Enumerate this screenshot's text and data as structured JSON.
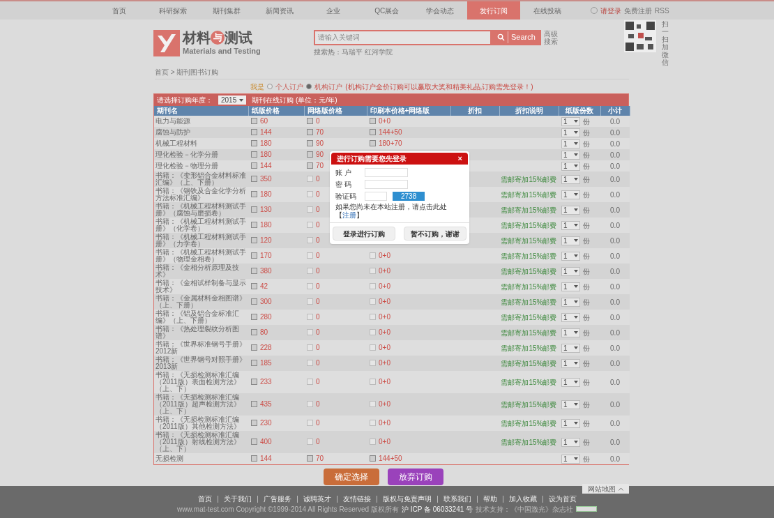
{
  "nav": {
    "items": [
      {
        "label": "首页",
        "selected": false
      },
      {
        "label": "科研探索",
        "selected": false
      },
      {
        "label": "期刊集群",
        "selected": false
      },
      {
        "label": "新闻资讯",
        "selected": false
      },
      {
        "label": "企业",
        "selected": false
      },
      {
        "label": "QC展会",
        "selected": false
      },
      {
        "label": "学会动态",
        "selected": false
      },
      {
        "label": "发行订阅",
        "selected": true
      },
      {
        "label": "在线投稿",
        "selected": false
      }
    ],
    "login": "请登录",
    "register": "免费注册",
    "rss": "RSS"
  },
  "header": {
    "logo_cn": "材料",
    "logo_mid": "与",
    "logo_cn2": "测试",
    "logo_en": "Materials and Testing",
    "search_placeholder": "请输入关键词",
    "search_button": "Search",
    "advanced": "高级搜索",
    "hot": "搜索热：马瑞平 红河学院",
    "qr_caption": "扫一扫加微信"
  },
  "breadcrumb": "首页 > 期刊图书订购",
  "subscriber": {
    "prefix": "我是",
    "options": [
      {
        "label": "个人订户",
        "selected": false
      },
      {
        "label": "机构订户",
        "selected": true
      }
    ],
    "note": "(机构订户全价订购可以赢取大奖和精美礼品,订购需先登录！)"
  },
  "table": {
    "year_label": "请选择订购年度：",
    "year": "2015",
    "caption": "期刊在线订购 (单位：元/年)",
    "columns": [
      "期刊名",
      "纸版价格",
      "网络版价格",
      "印刷本价格+网络版",
      "折扣",
      "折扣说明",
      "纸版份数",
      "小计"
    ],
    "rows": [
      {
        "name": "电力与能源",
        "paper": {
          "price": "60",
          "checked": false
        },
        "net": {
          "price": "0",
          "checked": false,
          "disabled": false
        },
        "print_net": {
          "price": "0+0",
          "checked": false,
          "disabled": false
        },
        "copies": "1",
        "unit": "份",
        "subtotal": "0.0"
      },
      {
        "name": "腐蚀与防护",
        "paper": {
          "price": "144",
          "checked": false
        },
        "net": {
          "price": "70",
          "checked": false,
          "disabled": false
        },
        "print_net": {
          "price": "144+50",
          "checked": false,
          "disabled": false
        },
        "copies": "1",
        "unit": "份",
        "subtotal": "0.0"
      },
      {
        "name": "机械工程材料",
        "paper": {
          "price": "180",
          "checked": false
        },
        "net": {
          "price": "90",
          "checked": false,
          "disabled": false
        },
        "print_net": {
          "price": "180+70",
          "checked": false,
          "disabled": false
        },
        "copies": "1",
        "unit": "份",
        "subtotal": "0.0"
      },
      {
        "name": "理化检验－化学分册",
        "paper": {
          "price": "180",
          "checked": false
        },
        "net": {
          "price": "90",
          "checked": false,
          "disabled": false
        },
        "copies": "1",
        "unit": "份",
        "subtotal": "0.0"
      },
      {
        "name": "理化检验－物理分册",
        "paper": {
          "price": "144",
          "checked": false
        },
        "net": {
          "price": "70",
          "checked": false,
          "disabled": false
        },
        "copies": "1",
        "unit": "份",
        "subtotal": "0.0"
      },
      {
        "name": "书籍：《变形铝合金材料标准汇编》（上、下册）",
        "paper": {
          "price": "350",
          "checked": false
        },
        "net": {
          "price": "0",
          "checked": false,
          "disabled": true
        },
        "note": "需邮寄加15%邮费",
        "copies": "1",
        "unit": "份",
        "subtotal": "0.0"
      },
      {
        "name": "书籍：《钢铁及合金化学分析方法标准汇编》",
        "paper": {
          "price": "180",
          "checked": false
        },
        "net": {
          "price": "0",
          "checked": false,
          "disabled": true
        },
        "note": "需邮寄加15%邮费",
        "copies": "1",
        "unit": "份",
        "subtotal": "0.0"
      },
      {
        "name": "书籍：《机械工程材料测试手册》（腐蚀与磨损卷）",
        "paper": {
          "price": "130",
          "checked": false
        },
        "net": {
          "price": "0",
          "checked": false,
          "disabled": true
        },
        "note": "需邮寄加15%邮费",
        "copies": "1",
        "unit": "份",
        "subtotal": "0.0"
      },
      {
        "name": "书籍：《机械工程材料测试手册》（化学卷）",
        "paper": {
          "price": "180",
          "checked": false
        },
        "net": {
          "price": "0",
          "checked": false,
          "disabled": true
        },
        "note": "需邮寄加15%邮费",
        "copies": "1",
        "unit": "份",
        "subtotal": "0.0"
      },
      {
        "name": "书籍：《机械工程材料测试手册》（力学卷）",
        "paper": {
          "price": "120",
          "checked": false
        },
        "net": {
          "price": "0",
          "checked": false,
          "disabled": true
        },
        "note": "需邮寄加15%邮费",
        "copies": "1",
        "unit": "份",
        "subtotal": "0.0"
      },
      {
        "name": "书籍：《机械工程材料测试手册》（物理金相卷）",
        "paper": {
          "price": "170",
          "checked": false
        },
        "net": {
          "price": "0",
          "checked": false,
          "disabled": true
        },
        "print_net": {
          "price": "0+0",
          "checked": false,
          "disabled": true
        },
        "note": "需邮寄加15%邮费",
        "copies": "1",
        "unit": "份",
        "subtotal": "0.0"
      },
      {
        "name": "书籍：《金相分析原理及技术》",
        "paper": {
          "price": "380",
          "checked": false
        },
        "net": {
          "price": "0",
          "checked": false,
          "disabled": true
        },
        "print_net": {
          "price": "0+0",
          "checked": false,
          "disabled": true
        },
        "note": "需邮寄加15%邮费",
        "copies": "1",
        "unit": "份",
        "subtotal": "0.0"
      },
      {
        "name": "书籍：《金相试样制备与显示技术》",
        "paper": {
          "price": "42",
          "checked": false
        },
        "net": {
          "price": "0",
          "checked": false,
          "disabled": true
        },
        "print_net": {
          "price": "0+0",
          "checked": false,
          "disabled": true
        },
        "note": "需邮寄加15%邮费",
        "copies": "1",
        "unit": "份",
        "subtotal": "0.0"
      },
      {
        "name": "书籍：《金属材料金相图谱》（上、下册）",
        "paper": {
          "price": "300",
          "checked": false
        },
        "net": {
          "price": "0",
          "checked": false,
          "disabled": true
        },
        "print_net": {
          "price": "0+0",
          "checked": false,
          "disabled": true
        },
        "note": "需邮寄加15%邮费",
        "copies": "1",
        "unit": "份",
        "subtotal": "0.0"
      },
      {
        "name": "书籍：《铝及铝合金标准汇编》（上、下册）",
        "paper": {
          "price": "280",
          "checked": false
        },
        "net": {
          "price": "0",
          "checked": false,
          "disabled": true
        },
        "print_net": {
          "price": "0+0",
          "checked": false,
          "disabled": true
        },
        "note": "需邮寄加15%邮费",
        "copies": "1",
        "unit": "份",
        "subtotal": "0.0"
      },
      {
        "name": "书籍：《热处理裂纹分析图谱》",
        "paper": {
          "price": "80",
          "checked": false
        },
        "net": {
          "price": "0",
          "checked": false,
          "disabled": true
        },
        "print_net": {
          "price": "0+0",
          "checked": false,
          "disabled": true
        },
        "note": "需邮寄加15%邮费",
        "copies": "1",
        "unit": "份",
        "subtotal": "0.0"
      },
      {
        "name": "书籍：《世界标准钢号手册》2012新",
        "paper": {
          "price": "228",
          "checked": false
        },
        "net": {
          "price": "0",
          "checked": false,
          "disabled": true
        },
        "print_net": {
          "price": "0+0",
          "checked": false,
          "disabled": true
        },
        "note": "需邮寄加15%邮费",
        "copies": "1",
        "unit": "份",
        "subtotal": "0.0"
      },
      {
        "name": "书籍：《世界钢号对照手册》2013新",
        "paper": {
          "price": "185",
          "checked": false
        },
        "net": {
          "price": "0",
          "checked": false,
          "disabled": true
        },
        "print_net": {
          "price": "0+0",
          "checked": false,
          "disabled": true
        },
        "note": "需邮寄加15%邮费",
        "copies": "1",
        "unit": "份",
        "subtotal": "0.0"
      },
      {
        "name": "书籍：《无损检测标准汇编（2011版）表面检测方法》（上、下）",
        "paper": {
          "price": "233",
          "checked": false
        },
        "net": {
          "price": "0",
          "checked": false,
          "disabled": true
        },
        "print_net": {
          "price": "0+0",
          "checked": false,
          "disabled": true
        },
        "note": "需邮寄加15%邮费",
        "copies": "1",
        "unit": "份",
        "subtotal": "0.0"
      },
      {
        "name": "书籍：《无损检测标准汇编（2011版）超声检测方法》（上、下）",
        "paper": {
          "price": "435",
          "checked": false
        },
        "net": {
          "price": "0",
          "checked": false,
          "disabled": true
        },
        "print_net": {
          "price": "0+0",
          "checked": false,
          "disabled": true
        },
        "note": "需邮寄加15%邮费",
        "copies": "1",
        "unit": "份",
        "subtotal": "0.0"
      },
      {
        "name": "书籍：《无损检测标准汇编（2011版）其他检测方法》",
        "paper": {
          "price": "230",
          "checked": false
        },
        "net": {
          "price": "0",
          "checked": false,
          "disabled": true
        },
        "print_net": {
          "price": "0+0",
          "checked": false,
          "disabled": true
        },
        "note": "需邮寄加15%邮费",
        "copies": "1",
        "unit": "份",
        "subtotal": "0.0"
      },
      {
        "name": "书籍：《无损检测标准汇编（2011版）射线检测方法》（上、下）",
        "paper": {
          "price": "400",
          "checked": false
        },
        "net": {
          "price": "0",
          "checked": false,
          "disabled": true
        },
        "print_net": {
          "price": "0+0",
          "checked": false,
          "disabled": true
        },
        "note": "需邮寄加15%邮费",
        "copies": "1",
        "unit": "份",
        "subtotal": "0.0"
      },
      {
        "name": "无损检测",
        "paper": {
          "price": "144",
          "checked": false
        },
        "net": {
          "price": "70",
          "checked": false,
          "disabled": false
        },
        "print_net": {
          "price": "144+50",
          "checked": false,
          "disabled": false
        },
        "copies": "1",
        "unit": "份",
        "subtotal": "0.0"
      }
    ]
  },
  "dialog": {
    "title": "进行订购需要您先登录",
    "close": "×",
    "account_label": "账 户",
    "password_label": "密 码",
    "captcha_label": "验证码",
    "captcha": "2738",
    "hint": "如果您尚未在本站注册，请点击此处【",
    "hint_link": "注册",
    "hint_end": "】",
    "login_button": "登录进行订购",
    "cancel_button": "暂不订购，谢谢"
  },
  "actions": [
    "确定选择",
    "放弃订购"
  ],
  "footer": {
    "sitemap": "网站地图",
    "links": [
      "首页",
      "关于我们",
      "广告服务",
      "诚聘英才",
      "友情链接",
      "版权与免责声明",
      "联系我们",
      "帮助",
      "加入收藏",
      "设为首页"
    ],
    "copyright": "www.mat-test.com Copyright ©1999-2014 All Rights Reserved 版权所有",
    "icp": "沪 ICP 备 06033241 号",
    "support": "技术支持：《中国激光》杂志社"
  }
}
